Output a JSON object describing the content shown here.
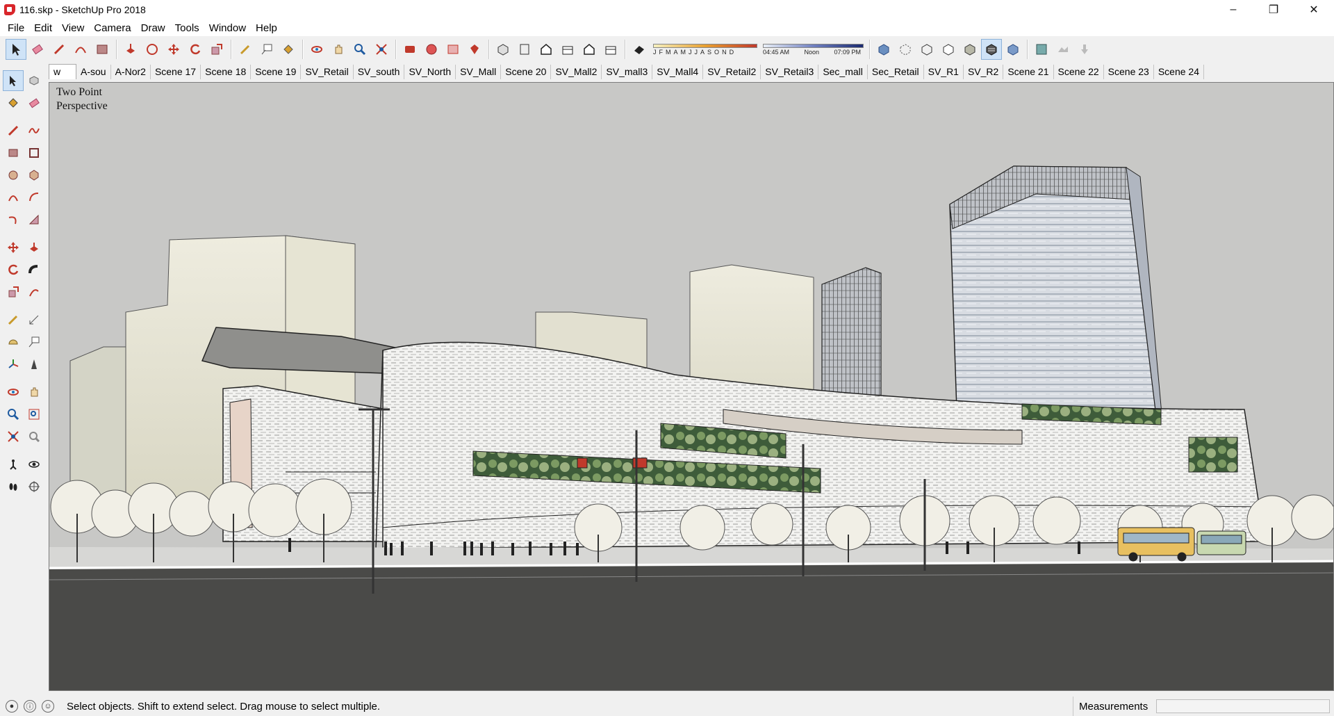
{
  "window": {
    "title": "116.skp - SketchUp Pro 2018",
    "controls": [
      "minimize",
      "maximize",
      "close"
    ]
  },
  "menu": [
    "File",
    "Edit",
    "View",
    "Camera",
    "Draw",
    "Tools",
    "Window",
    "Help"
  ],
  "toolbar": {
    "shadow_months": [
      "J",
      "F",
      "M",
      "A",
      "M",
      "J",
      "J",
      "A",
      "S",
      "O",
      "N",
      "D"
    ],
    "shadow_times": [
      "04:45 AM",
      "Noon",
      "07:09 PM"
    ]
  },
  "scenes": {
    "current": "w",
    "tabs": [
      "A-sou",
      "A-Nor2",
      "Scene 17",
      "Scene 18",
      "Scene 19",
      "SV_Retail",
      "SV_south",
      "SV_North",
      "SV_Mall",
      "Scene 20",
      "SV_Mall2",
      "SV_mall3",
      "SV_Mall4",
      "SV_Retail2",
      "SV_Retail3",
      "Sec_mall",
      "Sec_Retail",
      "SV_R1",
      "SV_R2",
      "Scene 21",
      "Scene 22",
      "Scene 23",
      "Scene 24"
    ]
  },
  "viewport": {
    "camera_label_line1": "Two Point",
    "camera_label_line2": "Perspective"
  },
  "status": {
    "hint": "Select objects. Shift to extend select. Drag mouse to select multiple.",
    "measurements_label": "Measurements",
    "measurements_value": ""
  },
  "colors": {
    "sky": "#c8c8c6",
    "road": "#4a4a48",
    "facade": "#efefec",
    "glass_block": "#e8e6d8",
    "tower": "#d8dce2",
    "accent": "#d9262b"
  }
}
